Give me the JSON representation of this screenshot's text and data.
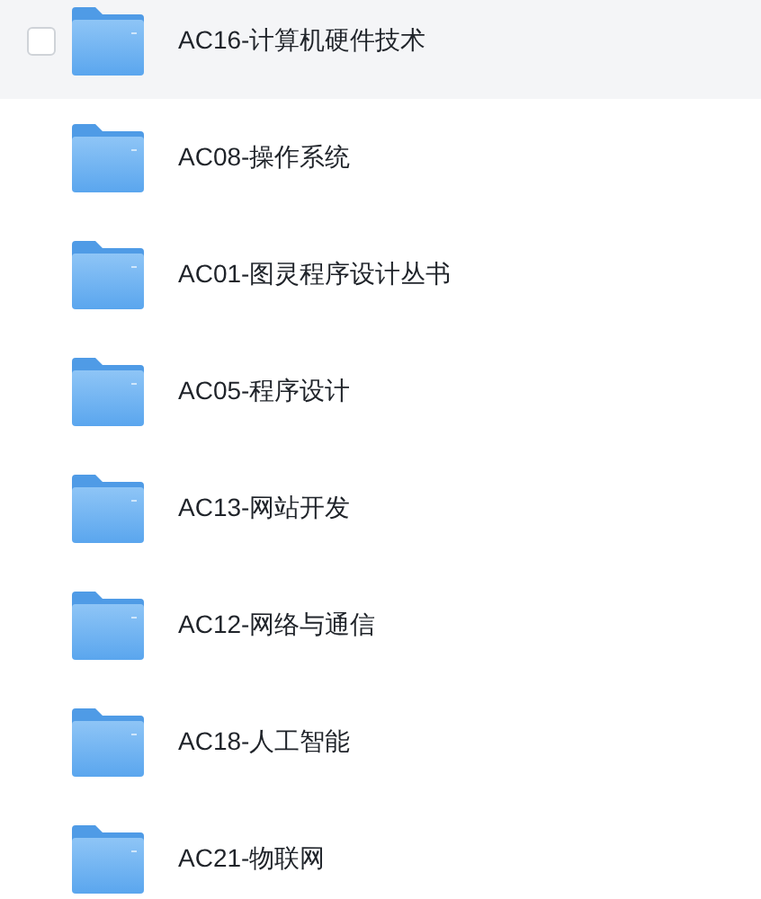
{
  "folders": [
    {
      "name": "AC16-计算机硬件技术",
      "highlighted": true,
      "checked": false
    },
    {
      "name": "AC08-操作系统",
      "highlighted": false,
      "checked": false
    },
    {
      "name": "AC01-图灵程序设计丛书",
      "highlighted": false,
      "checked": false
    },
    {
      "name": "AC05-程序设计",
      "highlighted": false,
      "checked": false
    },
    {
      "name": "AC13-网站开发",
      "highlighted": false,
      "checked": false
    },
    {
      "name": "AC12-网络与通信",
      "highlighted": false,
      "checked": false
    },
    {
      "name": "AC18-人工智能",
      "highlighted": false,
      "checked": false
    },
    {
      "name": "AC21-物联网",
      "highlighted": false,
      "checked": false
    }
  ]
}
